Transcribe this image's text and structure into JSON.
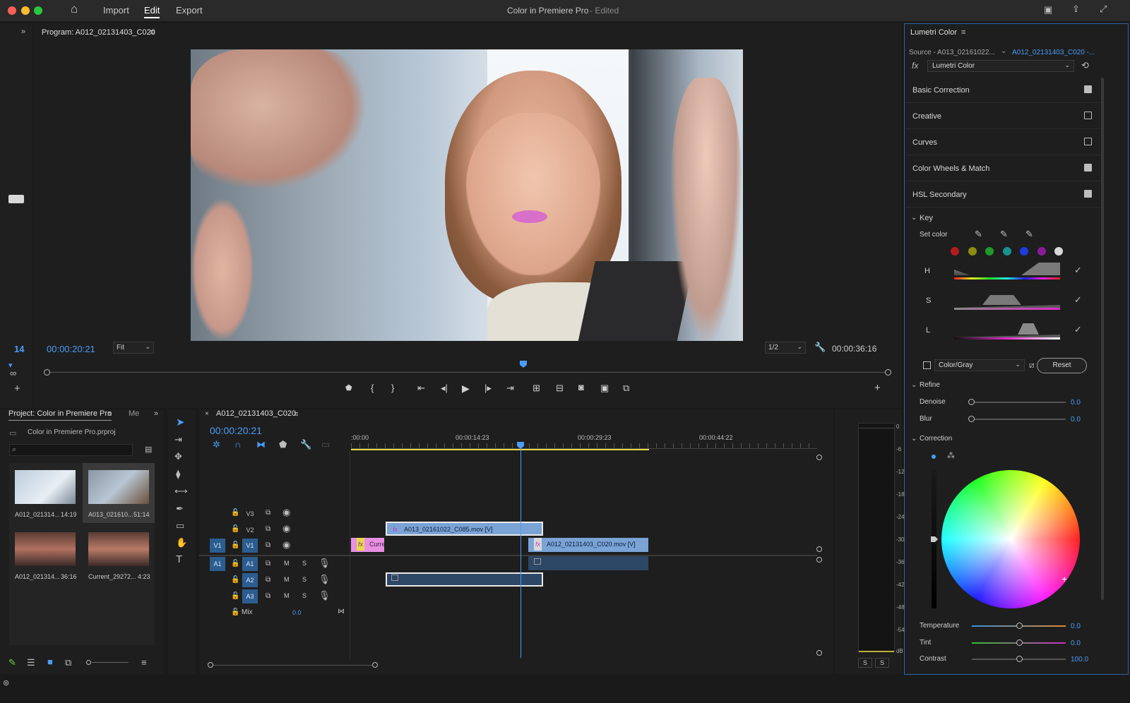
{
  "window": {
    "title": "Color in Premiere Pro",
    "title_suffix": "- Edited",
    "menu": [
      "Import",
      "Edit",
      "Export"
    ],
    "active_menu": "Edit"
  },
  "program_monitor": {
    "title": "Program: A012_02131403_C020",
    "frame": "14",
    "timecode": "00:00:20:21",
    "fit": "Fit",
    "resolution": "1/2",
    "duration": "00:00:36:16"
  },
  "project": {
    "tab": "Project: Color in Premiere Pro",
    "tab2": "Me",
    "file": "Color in Premiere Pro.prproj",
    "search_placeholder": "",
    "items": [
      {
        "name": "A012_021314...",
        "duration": "14:19"
      },
      {
        "name": "A013_021610...",
        "duration": "51:14"
      },
      {
        "name": "A012_021314...",
        "duration": "36:16"
      },
      {
        "name": "Current_29272...",
        "duration": "4:23"
      }
    ]
  },
  "timeline": {
    "sequence": "A012_02131403_C020",
    "timecode": "00:00:20:21",
    "ruler": [
      ":00:00",
      "00:00:14:23",
      "00:00:29:23",
      "00:00:44:22"
    ],
    "tracks": {
      "v3": "V3",
      "v2": "V2",
      "v1": "V1",
      "v1src": "V1",
      "a1src": "A1",
      "a1": "A1",
      "a2": "A2",
      "a3": "A3",
      "m": "M",
      "s": "S",
      "mix": "Mix",
      "mix_val": "0.0"
    },
    "clips": {
      "v2": "A013_02161022_C085.mov [V]",
      "v1a": "Curre",
      "v1b": "A012_02131403_C020.mov [V]"
    },
    "meter": [
      "0",
      "-6",
      "-12",
      "-18",
      "-24",
      "-30",
      "-36",
      "-42",
      "-48",
      "-54",
      "dB"
    ],
    "meter_solo": [
      "S",
      "S"
    ]
  },
  "lumetri": {
    "title": "Lumetri Color",
    "source": "Source - A013_02161022...",
    "target": "A012_02131403_C020 -...",
    "effect": "Lumetri Color",
    "sections": [
      {
        "label": "Basic Correction",
        "on": true
      },
      {
        "label": "Creative",
        "on": false
      },
      {
        "label": "Curves",
        "on": false
      },
      {
        "label": "Color Wheels & Match",
        "on": true
      },
      {
        "label": "HSL Secondary",
        "on": true
      }
    ],
    "key": "Key",
    "set_color": "Set color",
    "hsl": [
      "H",
      "S",
      "L"
    ],
    "color_gray": "Color/Gray",
    "reset": "Reset",
    "refine": "Refine",
    "denoise": {
      "label": "Denoise",
      "value": "0.0"
    },
    "blur": {
      "label": "Blur",
      "value": "0.0"
    },
    "correction": "Correction",
    "temperature": {
      "label": "Temperature",
      "value": "0.0"
    },
    "tint": {
      "label": "Tint",
      "value": "0.0"
    },
    "contrast": {
      "label": "Contrast",
      "value": "100.0"
    },
    "swatches": [
      "#b01c1c",
      "#8c8c10",
      "#1f9a2a",
      "#1a9090",
      "#1d3de0",
      "#8a1a9a",
      "#d8d8d8"
    ]
  },
  "colors": {
    "accent": "#4a9cf5",
    "playhead": "#3d8ef0",
    "clip": "#7aa3d6",
    "clip_pink": "#e88fe4"
  }
}
